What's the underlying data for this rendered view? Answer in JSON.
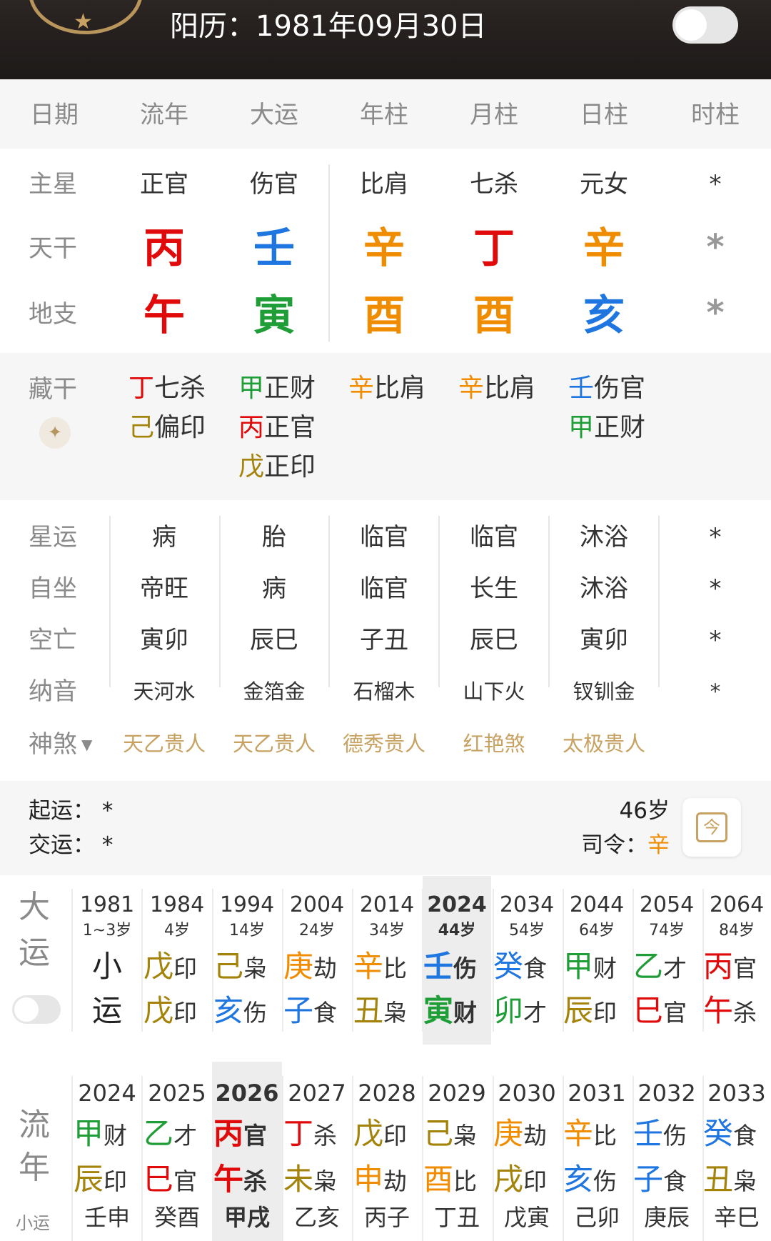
{
  "header": {
    "solar_label": "阳历：",
    "solar_date": "1981年09月30日"
  },
  "columns": [
    "日期",
    "流年",
    "大运",
    "年柱",
    "月柱",
    "日柱",
    "时柱"
  ],
  "pillars": {
    "main_star_label": "主星",
    "main_stars": [
      "正官",
      "伤官",
      "比肩",
      "七杀",
      "元女",
      "*"
    ],
    "stem_label": "天干",
    "stems": [
      "丙",
      "壬",
      "辛",
      "丁",
      "辛",
      "*"
    ],
    "branch_label": "地支",
    "branches": [
      "午",
      "寅",
      "酉",
      "酉",
      "亥",
      "*"
    ]
  },
  "hidden": {
    "label": "藏干",
    "cols": [
      [
        {
          "c": "丁",
          "t": "七杀"
        },
        {
          "c": "己",
          "t": "偏印"
        }
      ],
      [
        {
          "c": "甲",
          "t": "正财"
        },
        {
          "c": "丙",
          "t": "正官"
        },
        {
          "c": "戊",
          "t": "正印"
        }
      ],
      [
        {
          "c": "辛",
          "t": "比肩"
        }
      ],
      [
        {
          "c": "辛",
          "t": "比肩"
        }
      ],
      [
        {
          "c": "壬",
          "t": "伤官"
        },
        {
          "c": "甲",
          "t": "正财"
        }
      ]
    ]
  },
  "rows": [
    {
      "label": "星运",
      "values": [
        "病",
        "胎",
        "临官",
        "临官",
        "沐浴",
        "*"
      ]
    },
    {
      "label": "自坐",
      "values": [
        "帝旺",
        "病",
        "临官",
        "长生",
        "沐浴",
        "*"
      ]
    },
    {
      "label": "空亡",
      "values": [
        "寅卯",
        "辰巳",
        "子丑",
        "辰巳",
        "寅卯",
        "*"
      ]
    },
    {
      "label": "纳音",
      "values": [
        "天河水",
        "金箔金",
        "石榴木",
        "山下火",
        "钗钏金",
        "*"
      ]
    }
  ],
  "shensha": {
    "label": "神煞",
    "values": [
      "天乙贵人",
      "天乙贵人",
      "德秀贵人",
      "红艳煞",
      "太极贵人"
    ]
  },
  "luck_info": {
    "qiyun_label": "起运：",
    "qiyun_value": "*",
    "jiaoyun_label": "交运：",
    "jiaoyun_value": "*",
    "age": "46岁",
    "siling_label": "司令：",
    "siling_value": "辛",
    "calendar_glyph": "今"
  },
  "dayun": {
    "label1": "大",
    "label2": "运",
    "cols": [
      {
        "year": "1981",
        "age": "1~3岁",
        "t": "小",
        "b": "运"
      },
      {
        "year": "1984",
        "age": "4岁",
        "tc": "戊",
        "ts": "印",
        "bc": "戊",
        "bs": "印"
      },
      {
        "year": "1994",
        "age": "14岁",
        "tc": "己",
        "ts": "枭",
        "bc": "亥",
        "bs": "伤"
      },
      {
        "year": "2004",
        "age": "24岁",
        "tc": "庚",
        "ts": "劫",
        "bc": "子",
        "bs": "食"
      },
      {
        "year": "2014",
        "age": "34岁",
        "tc": "辛",
        "ts": "比",
        "bc": "丑",
        "bs": "枭"
      },
      {
        "year": "2024",
        "age": "44岁",
        "tc": "壬",
        "ts": "伤",
        "bc": "寅",
        "bs": "财"
      },
      {
        "year": "2034",
        "age": "54岁",
        "tc": "癸",
        "ts": "食",
        "bc": "卯",
        "bs": "才"
      },
      {
        "year": "2044",
        "age": "64岁",
        "tc": "甲",
        "ts": "财",
        "bc": "辰",
        "bs": "印"
      },
      {
        "year": "2054",
        "age": "74岁",
        "tc": "乙",
        "ts": "才",
        "bc": "巳",
        "bs": "官"
      },
      {
        "year": "2064",
        "age": "84岁",
        "tc": "丙",
        "ts": "官",
        "bc": "午",
        "bs": "杀"
      }
    ]
  },
  "liunian": {
    "label1": "流",
    "label2": "年",
    "xiaoyun": "小运",
    "cols": [
      {
        "year": "2024",
        "tc": "甲",
        "ts": "财",
        "bc": "辰",
        "bs": "印",
        "x": "壬申"
      },
      {
        "year": "2025",
        "tc": "乙",
        "ts": "才",
        "bc": "巳",
        "bs": "官",
        "x": "癸酉"
      },
      {
        "year": "2026",
        "tc": "丙",
        "ts": "官",
        "bc": "午",
        "bs": "杀",
        "x": "甲戌"
      },
      {
        "year": "2027",
        "tc": "丁",
        "ts": "杀",
        "bc": "未",
        "bs": "枭",
        "x": "乙亥"
      },
      {
        "year": "2028",
        "tc": "戊",
        "ts": "印",
        "bc": "申",
        "bs": "劫",
        "x": "丙子"
      },
      {
        "year": "2029",
        "tc": "己",
        "ts": "枭",
        "bc": "酉",
        "bs": "比",
        "x": "丁丑"
      },
      {
        "year": "2030",
        "tc": "庚",
        "ts": "劫",
        "bc": "戌",
        "bs": "印",
        "x": "戊寅"
      },
      {
        "year": "2031",
        "tc": "辛",
        "ts": "比",
        "bc": "亥",
        "bs": "伤",
        "x": "己卯"
      },
      {
        "year": "2032",
        "tc": "壬",
        "ts": "伤",
        "bc": "子",
        "bs": "食",
        "x": "庚辰"
      },
      {
        "year": "2033",
        "tc": "癸",
        "ts": "食",
        "bc": "丑",
        "bs": "枭",
        "x": "辛巳"
      }
    ]
  },
  "colors": {
    "fire": "#e00a0a",
    "water": "#1f76e0",
    "metal": "#f08c00",
    "wood": "#1f9d36",
    "earth": "#a4830b",
    "gold": "#c7a262"
  }
}
